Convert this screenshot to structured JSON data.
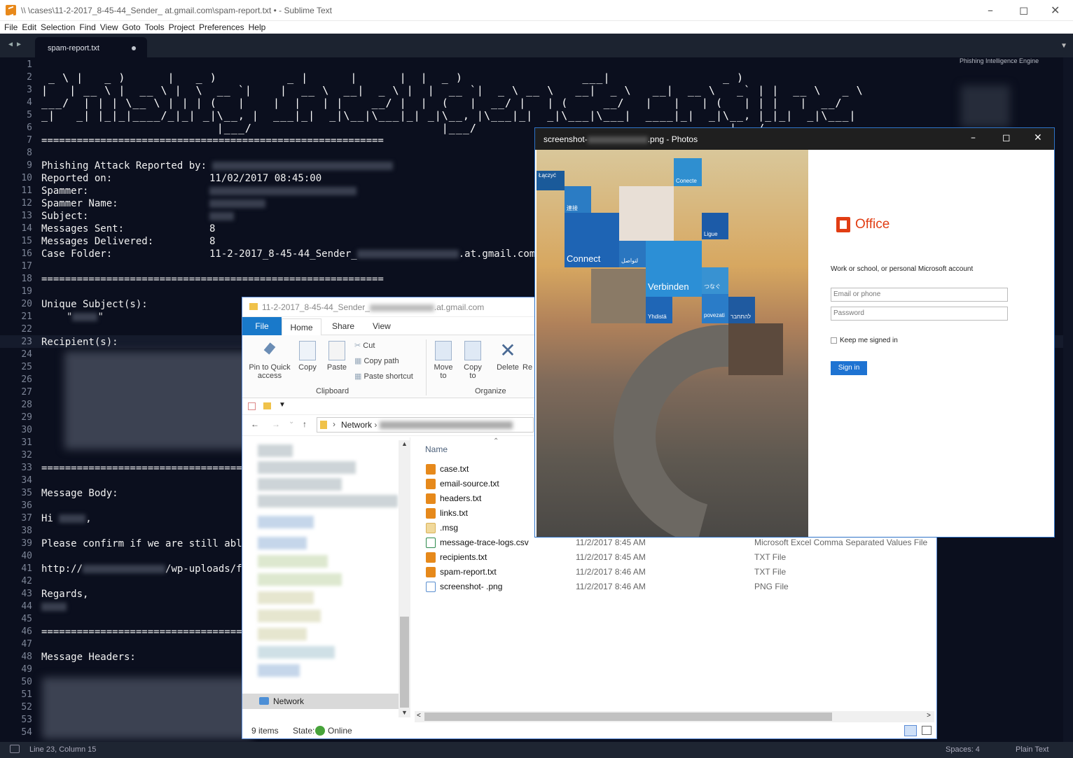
{
  "sublime": {
    "title": "\\\\                \\cases\\11-2-2017_8-45-44_Sender_               at.gmail.com\\spam-report.txt • - Sublime Text",
    "menu": [
      "File",
      "Edit",
      "Selection",
      "Find",
      "View",
      "Goto",
      "Tools",
      "Project",
      "Preferences",
      "Help"
    ],
    "tab": "spam-report.txt",
    "line_numbers": [
      "1",
      "2",
      "3",
      "4",
      "5",
      "6",
      "7",
      "8",
      "9",
      "10",
      "11",
      "12",
      "13",
      "14",
      "15",
      "16",
      "17",
      "18",
      "19",
      "20",
      "21",
      "22",
      "23",
      "24",
      "25",
      "26",
      "27",
      "28",
      "29",
      "30",
      "31",
      "32",
      "33",
      "34",
      "35",
      "36",
      "37",
      "38",
      "39",
      "40",
      "41",
      "42",
      "43",
      "44",
      "45",
      "46",
      "47",
      "48",
      "49",
      "50",
      "51",
      "52",
      "53",
      "54"
    ],
    "banner": "Phishing Intelligence Engine",
    "separator": "==========================================================",
    "fields": {
      "reported_by": "Phishing Attack Reported by:",
      "reported_on_label": "Reported on:",
      "reported_on_value": "11/02/2017 08:45:00",
      "spammer": "Spammer:",
      "spammer_name": "Spammer Name:",
      "subject": "Subject:",
      "messages_sent_label": "Messages Sent:",
      "messages_sent_value": "8",
      "messages_delivered_label": "Messages Delivered:",
      "messages_delivered_value": "8",
      "case_folder_label": "Case Folder:",
      "case_folder_prefix": "11-2-2017_8-45-44_Sender_",
      "case_folder_suffix": ".at.gmail.com",
      "unique_subjects": "Unique Subject(s):",
      "recipients": "Recipient(s):",
      "message_body": "Message Body:",
      "hi": "Hi",
      "confirm": "Please confirm if we are still able",
      "url_prefix": "http://",
      "url_path": "/wp-uploads/f",
      "regards": "Regards,",
      "message_headers": "Message Headers:"
    },
    "minimap_title": "Phishing Intelligence Engine",
    "status": {
      "position": "Line 23, Column 15",
      "spaces": "Spaces: 4",
      "syntax": "Plain Text"
    }
  },
  "explorer": {
    "title_prefix": "11-2-2017_8-45-44_Sender_",
    "title_suffix": ".at.gmail.com",
    "tabs": {
      "file": "File",
      "home": "Home",
      "share": "Share",
      "view": "View"
    },
    "ribbon": {
      "pin": "Pin to Quick access",
      "copy": "Copy",
      "paste": "Paste",
      "cut": "Cut",
      "copy_path": "Copy path",
      "paste_shortcut": "Paste shortcut",
      "clipboard": "Clipboard",
      "move_to": "Move to",
      "copy_to": "Copy to",
      "delete": "Delete",
      "rename": "Re",
      "organize": "Organize"
    },
    "address": "Network",
    "nav_network": "Network",
    "column_name": "Name",
    "files": [
      {
        "name": "case.txt",
        "date": "",
        "type": "",
        "icon": "sublime-icon"
      },
      {
        "name": "email-source.txt",
        "date": "",
        "type": "",
        "icon": "sublime-icon"
      },
      {
        "name": "headers.txt",
        "date": "",
        "type": "",
        "icon": "sublime-icon"
      },
      {
        "name": "links.txt",
        "date": "",
        "type": "",
        "icon": "sublime-icon"
      },
      {
        "name": ".msg",
        "date": "",
        "type": "",
        "icon": "outlook-msg-icon"
      },
      {
        "name": "message-trace-logs.csv",
        "date": "11/2/2017 8:45 AM",
        "type": "Microsoft Excel Comma Separated Values File",
        "icon": "excel-icon"
      },
      {
        "name": "recipients.txt",
        "date": "11/2/2017 8:45 AM",
        "type": "TXT File",
        "icon": "sublime-icon"
      },
      {
        "name": "spam-report.txt",
        "date": "11/2/2017 8:46 AM",
        "type": "TXT File",
        "icon": "sublime-icon"
      },
      {
        "name": "screenshot-               .png",
        "date": "11/2/2017 8:46 AM",
        "type": "PNG File",
        "icon": "image-icon"
      }
    ],
    "status_items": "9 items",
    "status_state": "State:",
    "status_online": "Online"
  },
  "photos": {
    "title_prefix": "screenshot-",
    "title_suffix": ".png - Photos",
    "tiles": [
      "Łączyć",
      "Conecte",
      "連接",
      "Ligue",
      "Connect",
      "لتواصل",
      "Verbinden",
      "つなぐ",
      "Yhdistä",
      "povezati",
      "להתחבר"
    ],
    "office": "Office",
    "account_label": "Work or school, or personal Microsoft account",
    "email_placeholder": "Email or phone",
    "password_placeholder": "Password",
    "keep_signed_in": "Keep me signed in",
    "sign_in": "Sign in"
  },
  "colors": {
    "editor_bg": "#0b0f1e",
    "office_red": "#e13d13",
    "ms_blue": "#1e73d2",
    "explorer_blue": "#1979ca"
  }
}
